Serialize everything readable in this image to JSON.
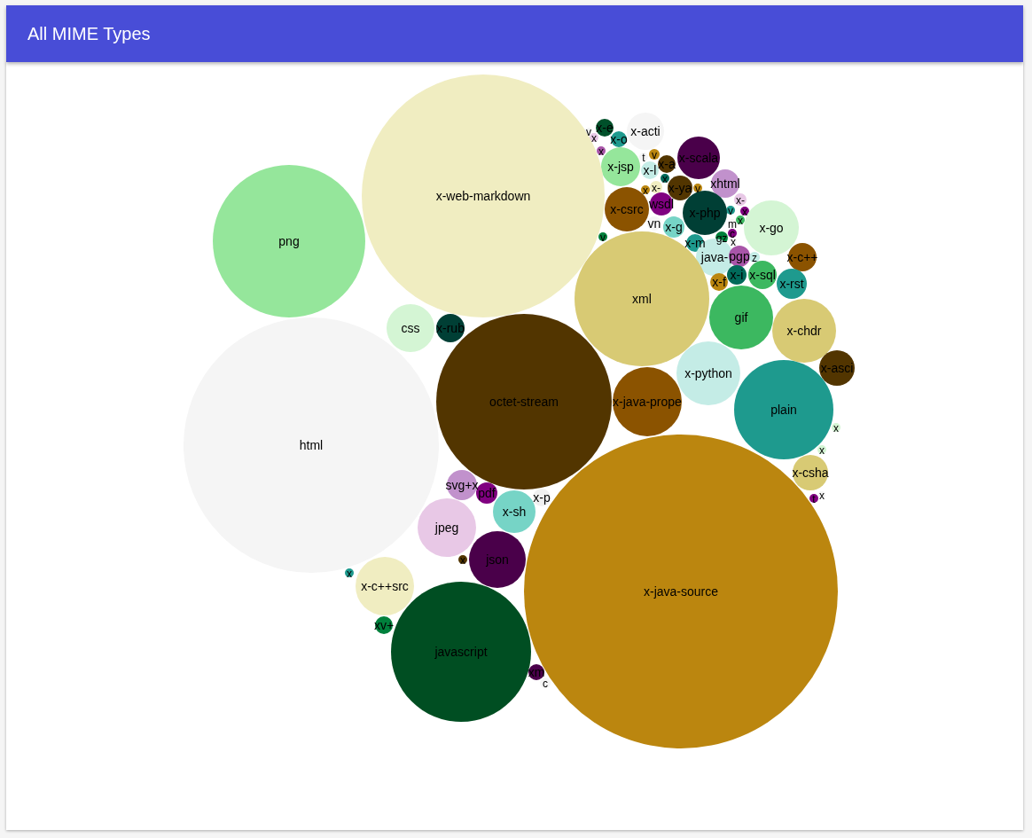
{
  "header": {
    "title": "All MIME Types"
  },
  "bubbles": [
    {
      "label": "v",
      "color": "#f5f5f5"
    },
    {
      "label": "x-e",
      "color": "#00502a"
    },
    {
      "label": "x-acti",
      "color": "#f5f5f5"
    },
    {
      "label": "x",
      "color": "#e8c8e6"
    },
    {
      "label": "x-o",
      "color": "#1e9a8e"
    },
    {
      "label": "x",
      "color": "#a855a8"
    },
    {
      "label": "t",
      "color": "#f5f5f5"
    },
    {
      "label": "v",
      "color": "#bb860f"
    },
    {
      "label": "x-scala",
      "color": "#4a004a"
    },
    {
      "label": "x-jsp",
      "color": "#95e69b"
    },
    {
      "label": "x-l",
      "color": "#c4ece6"
    },
    {
      "label": "x-a",
      "color": "#523500"
    },
    {
      "label": "x",
      "color": "#006a5a"
    },
    {
      "label": "xhtml",
      "color": "#c191cc"
    },
    {
      "label": "x-web-markdown",
      "color": "#f0edc1"
    },
    {
      "label": "x",
      "color": "#bb860f"
    },
    {
      "label": "x-",
      "color": "#f0edc1"
    },
    {
      "label": "x-ya",
      "color": "#523500"
    },
    {
      "label": "v",
      "color": "#bb860f"
    },
    {
      "label": "x-csrc",
      "color": "#8b5300"
    },
    {
      "label": "wsdl",
      "color": "#800080"
    },
    {
      "label": "v",
      "color": "#1e9a8e"
    },
    {
      "label": "x-",
      "color": "#e8c8e6"
    },
    {
      "label": "x",
      "color": "#800080"
    },
    {
      "label": "vn",
      "color": "#f5f5f5"
    },
    {
      "label": "x-php",
      "color": "#003f35"
    },
    {
      "label": "m",
      "color": "#f5f5f5"
    },
    {
      "label": "x",
      "color": "#3cb860"
    },
    {
      "label": "v",
      "color": "#00803c"
    },
    {
      "label": "x-g",
      "color": "#76d4c6"
    },
    {
      "label": "gz",
      "color": "#00803c"
    },
    {
      "label": "c",
      "color": "#800080"
    },
    {
      "label": "x-go",
      "color": "#d4f5d4"
    },
    {
      "label": "png",
      "color": "#95e69b"
    },
    {
      "label": "x-m",
      "color": "#1e9a8e"
    },
    {
      "label": "x",
      "color": "#f5f5f5"
    },
    {
      "label": "java-",
      "color": "#c4ece6"
    },
    {
      "label": "pgp",
      "color": "#a855a8"
    },
    {
      "label": "z",
      "color": "#c4ece6"
    },
    {
      "label": "x-c++",
      "color": "#8b5300"
    },
    {
      "label": "x-i",
      "color": "#006a5a"
    },
    {
      "label": "x-sql",
      "color": "#3cb860"
    },
    {
      "label": "x-f",
      "color": "#bb860f"
    },
    {
      "label": "x-rst",
      "color": "#1e9a8e"
    },
    {
      "label": "xml",
      "color": "#d8ca74"
    },
    {
      "label": "gif",
      "color": "#3cb860"
    },
    {
      "label": "css",
      "color": "#d4f5d4"
    },
    {
      "label": "x-rub",
      "color": "#003f35"
    },
    {
      "label": "x-chdr",
      "color": "#d8ca74"
    },
    {
      "label": "x-asci",
      "color": "#523500"
    },
    {
      "label": "x-python",
      "color": "#c4ece6"
    },
    {
      "label": "octet-stream",
      "color": "#523500"
    },
    {
      "label": "x-java-prope",
      "color": "#8b5300"
    },
    {
      "label": "plain",
      "color": "#1e9a8e"
    },
    {
      "label": "x",
      "color": "#d4f5d4"
    },
    {
      "label": "html",
      "color": "#f5f5f5"
    },
    {
      "label": "x",
      "color": "#d4f5d4"
    },
    {
      "label": "x-csha",
      "color": "#d8ca74"
    },
    {
      "label": "svg+x",
      "color": "#c191cc"
    },
    {
      "label": "pdf",
      "color": "#800080"
    },
    {
      "label": "x-p",
      "color": "#f0f0f0"
    },
    {
      "label": "t",
      "color": "#800080"
    },
    {
      "label": "x",
      "color": "#f5f5f5"
    },
    {
      "label": "x-sh",
      "color": "#76d4c6"
    },
    {
      "label": "jpeg",
      "color": "#e8c8e6"
    },
    {
      "label": "x",
      "color": "#523500"
    },
    {
      "label": "json",
      "color": "#4a004a"
    },
    {
      "label": "x",
      "color": "#1e9a8e"
    },
    {
      "label": "x-c++src",
      "color": "#f0edc1"
    },
    {
      "label": "x-java-source",
      "color": "#bb860f"
    },
    {
      "label": "xv+",
      "color": "#00803c"
    },
    {
      "label": "javascript",
      "color": "#004e22"
    },
    {
      "label": "xm",
      "color": "#4a004a"
    },
    {
      "label": "c",
      "color": "#f5f5f5"
    }
  ]
}
